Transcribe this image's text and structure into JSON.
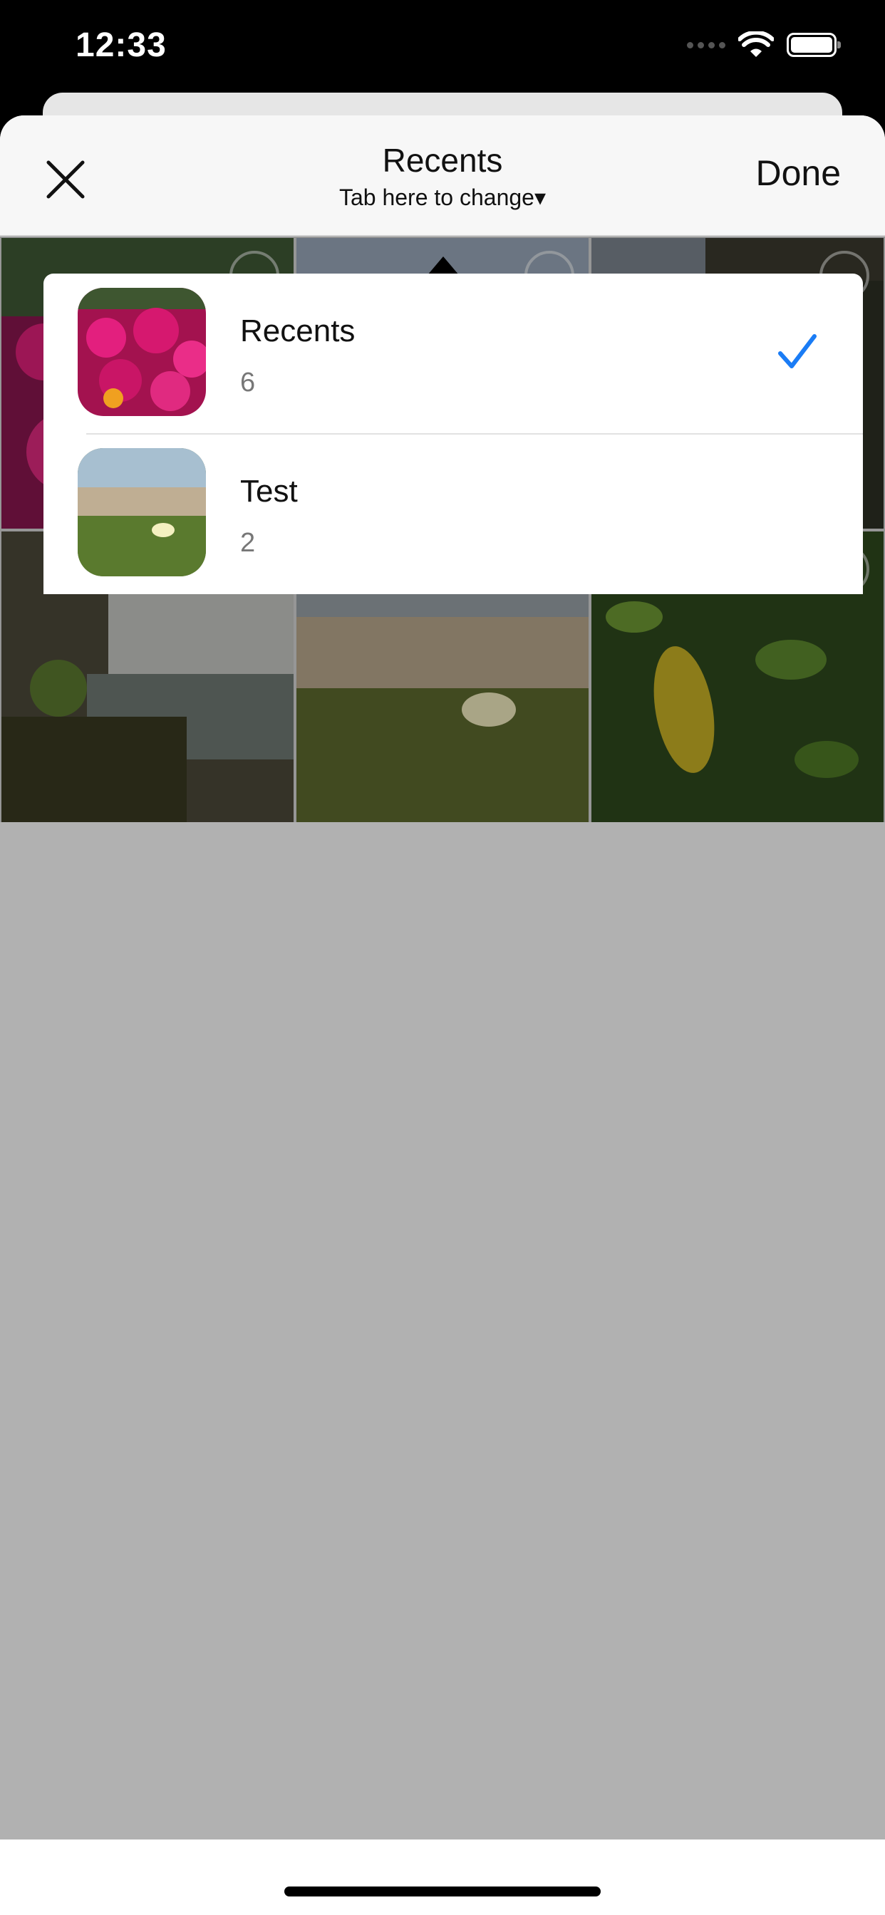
{
  "status_bar": {
    "time": "12:33"
  },
  "header": {
    "title": "Recents",
    "subtitle": "Tab here to change▾",
    "done_label": "Done"
  },
  "albums": [
    {
      "name": "Recents",
      "count": "6",
      "selected": true
    },
    {
      "name": "Test",
      "count": "2",
      "selected": false
    }
  ],
  "photos": [
    {
      "subject": "pink flowers"
    },
    {
      "subject": "coastal sky"
    },
    {
      "subject": "rocky waterfall"
    },
    {
      "subject": "waterfall landscape"
    },
    {
      "subject": "yellow flower in grass"
    },
    {
      "subject": "green leaves"
    }
  ],
  "colors": {
    "accent": "#1a7cf5",
    "overlay_gray": "#b1b1b1"
  }
}
